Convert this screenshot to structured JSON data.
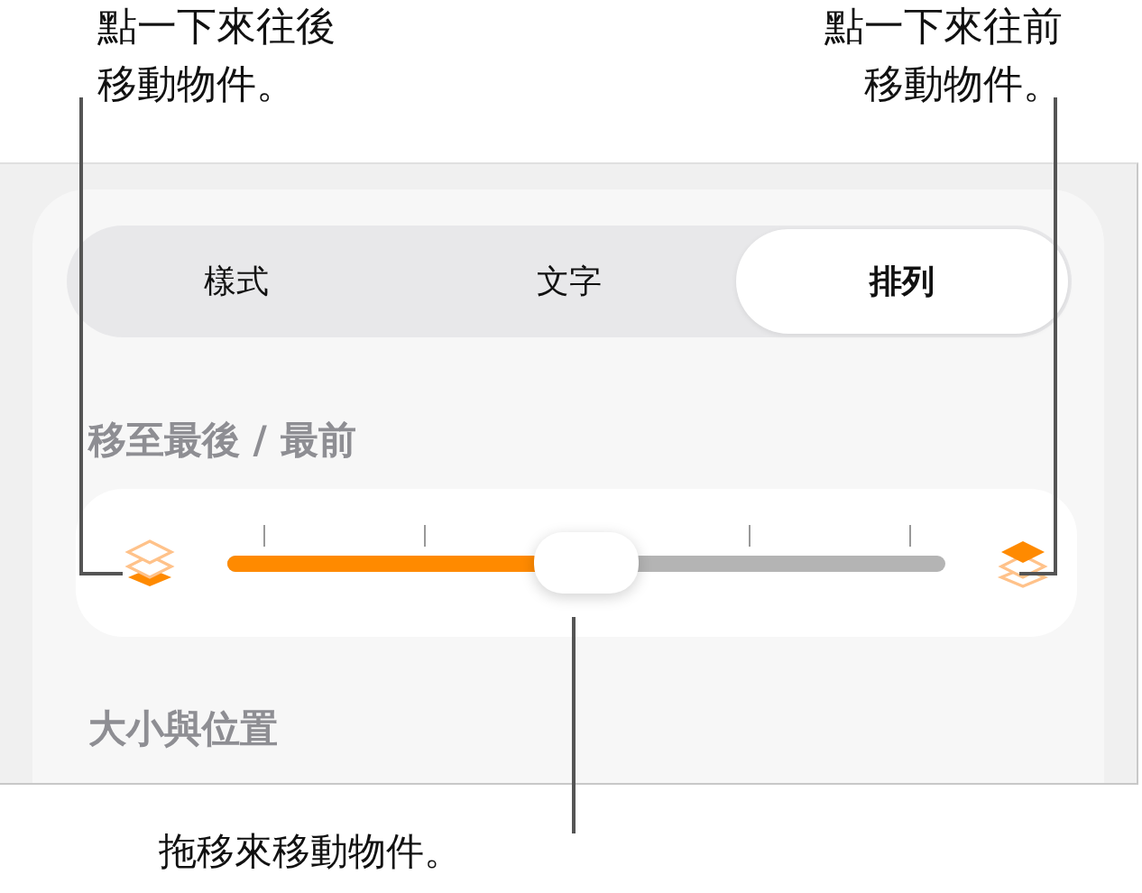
{
  "callouts": [
    {
      "lines": [
        "點一下來往後",
        "移動物件。"
      ]
    },
    {
      "lines": [
        "點一下來往前",
        "移動物件。"
      ]
    }
  ],
  "tabs": [
    {
      "label": "樣式",
      "selected": false
    },
    {
      "label": "文字",
      "selected": false
    },
    {
      "label": "排列",
      "selected": true
    }
  ],
  "arrange_heading": "移至最後 / 最前",
  "slider": {
    "level": 0.5
  },
  "size_heading": "大小與位置",
  "bottom_callout": "拖移來移動物件。"
}
